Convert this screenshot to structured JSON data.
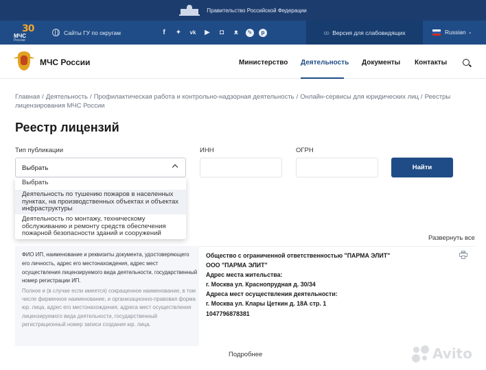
{
  "gov_strip": {
    "text": "Правительство Российской Федерации"
  },
  "top_bar": {
    "logo_number": "30",
    "logo_label": "МЧС",
    "logo_sub": "России",
    "sites_label": "Сайты ГУ по округам",
    "social_icons": [
      "facebook",
      "twitter",
      "vk",
      "youtube",
      "instagram",
      "odnoklassniki",
      "livejournal",
      "pinterest"
    ],
    "a11y_label": "Версия для слабовидящих",
    "language": "Russian"
  },
  "nav": {
    "brand": "МЧС России",
    "items": [
      {
        "label": "Министерство"
      },
      {
        "label": "Деятельность",
        "active": true
      },
      {
        "label": "Документы"
      },
      {
        "label": "Контакты"
      }
    ]
  },
  "breadcrumbs": [
    "Главная",
    "Деятельность",
    "Профилактическая работа и контрольно-надзорная деятельность",
    "Онлайн-сервисы для юридических лиц",
    "Реестры лицензирования МЧС России"
  ],
  "page_title": "Реестр лицензий",
  "filters": {
    "type_label": "Тип публикации",
    "type_value": "Выбрать",
    "inn_label": "ИНН",
    "ogrn_label": "ОГРН",
    "search_button": "Найти",
    "options": [
      "Выбрать",
      "Деятельность по тушению пожаров в населенных пунктах, на производственных объектах и объектах инфраструктуры",
      "Деятельность по монтажу, техническому обслуживанию и ремонту средств обеспечения пожарной безопасности зданий и сооружений"
    ]
  },
  "expand_all": "Развернуть все",
  "record": {
    "left_main": "ФИО ИП, наименование и реквизиты документа, удостоверяющего его личность, адрес его местонахождения, адрес мест осуществления лицензируемого вида деятельности, государственный номер регистрации ИП.",
    "left_sub": "Полное и (в случае если имеется) сокращенное наименование, в том числе фирменное наименование, и организационно-правовая форма юр. лица, адрес его местонахождения, адреса мест осуществления лицензируемого вида деятельности, государственный регистрационный номер записи создания юр. лица.",
    "lines": [
      "Общество с ограниченной ответственностью \"ПАРМА ЭЛИТ\"",
      "ООО \"ПАРМА ЭЛИТ\"",
      "Адрес места жительства:",
      "г. Москва ул. Краснопрудная д. 30/34",
      "Адреса мест осуществления деятельности:",
      "г. Москва ул. Клары Цеткин д. 18А стр. 1",
      "1047796878381"
    ]
  },
  "more_label": "Подробнее",
  "watermark": "Avito"
}
